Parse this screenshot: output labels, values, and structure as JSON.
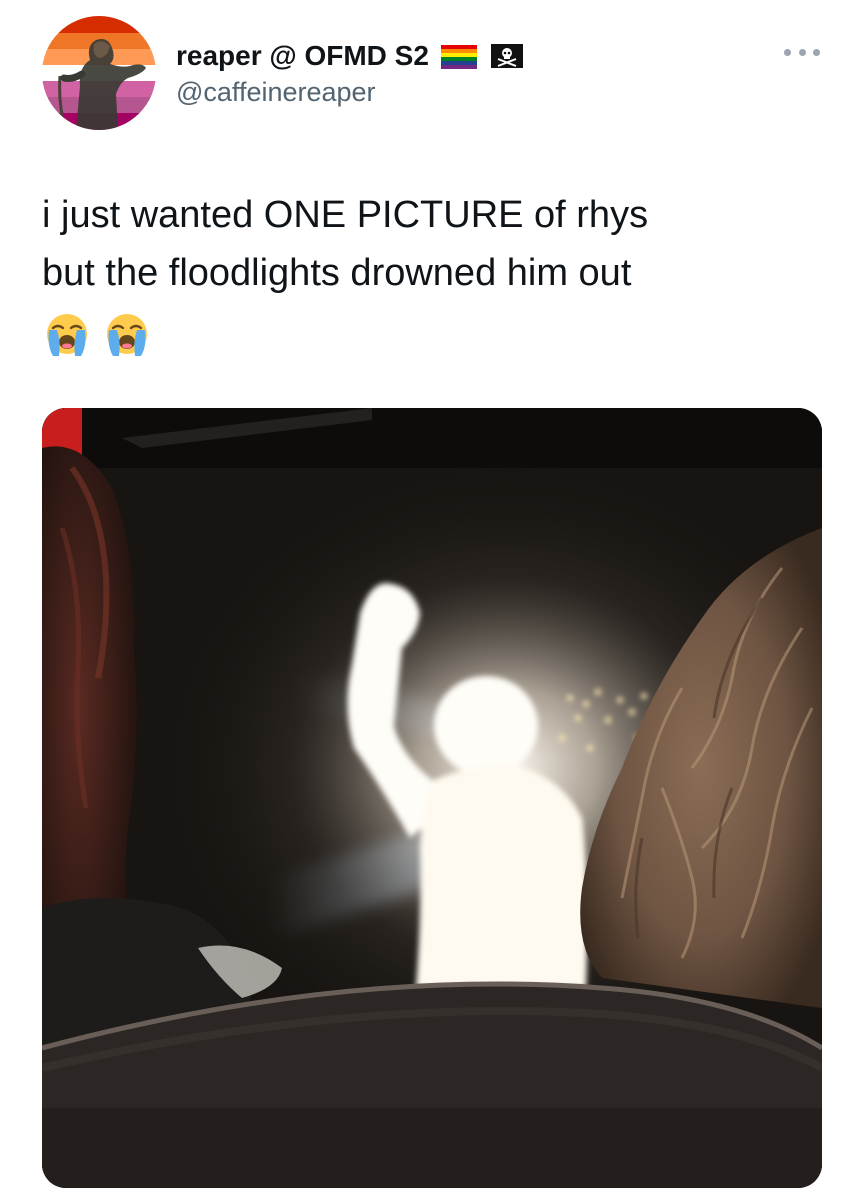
{
  "tweet": {
    "author": {
      "display_name": "reaper @ OFMD S2",
      "handle": "@caffeinereaper",
      "name_emoji": [
        "rainbow-flag-icon",
        "pirate-flag-icon"
      ]
    },
    "text_lines": [
      "i just wanted ONE PICTURE of rhys",
      "but the floodlights drowned him out"
    ],
    "text_emoji": [
      "loudly-crying-face-icon",
      "loudly-crying-face-icon"
    ],
    "media": {
      "type": "photo"
    }
  },
  "colors": {
    "text_primary": "#0f1419",
    "text_secondary": "#536471",
    "menu_dots": "#9aa5b0",
    "background": "#ffffff",
    "lesbian_flag": [
      "#d52d00",
      "#ef7627",
      "#ff9a56",
      "#ffffff",
      "#d162a4",
      "#b55690",
      "#a30262"
    ]
  }
}
